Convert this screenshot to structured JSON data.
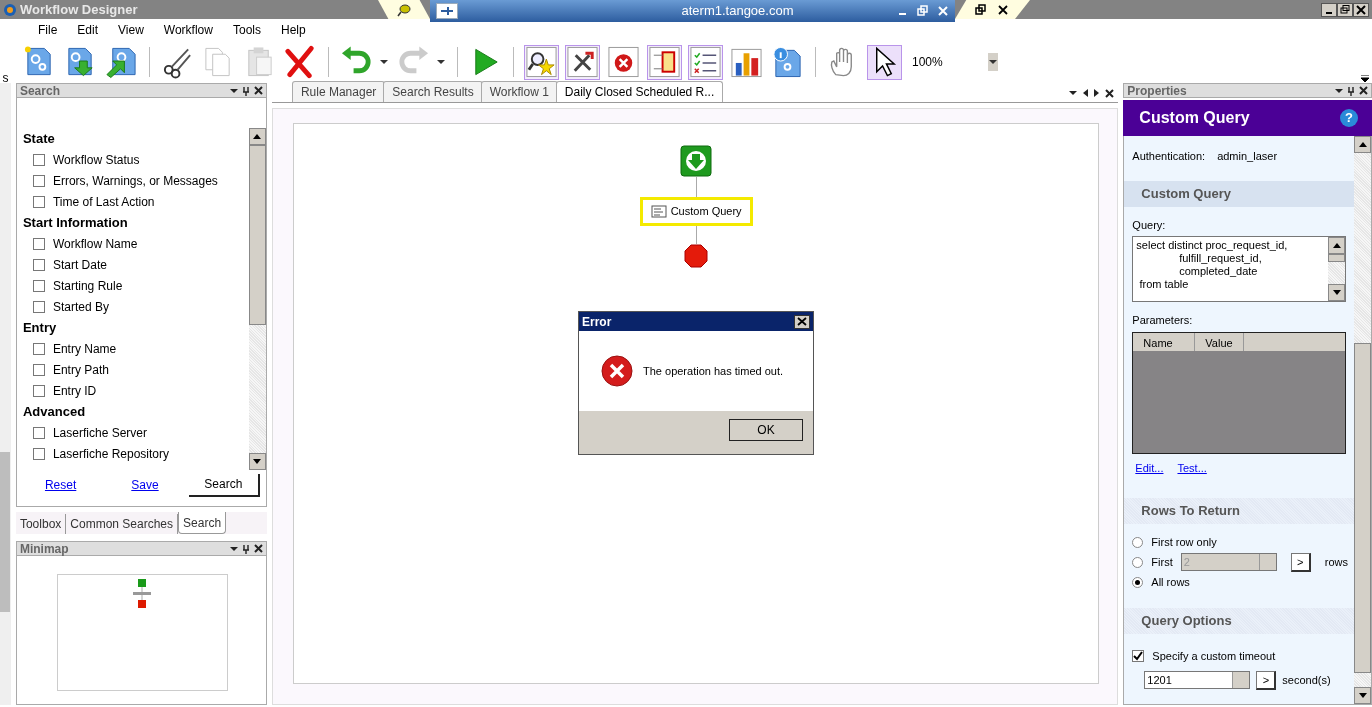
{
  "title_bar": {
    "title": "Workflow Designer"
  },
  "remote_bar": {
    "host": "aterm1.tangoe.com"
  },
  "menu": [
    "File",
    "Edit",
    "View",
    "Workflow",
    "Tools",
    "Help"
  ],
  "left_strip": {
    "label": "s"
  },
  "toolbar": {
    "buttons": [
      {
        "pressed": false,
        "disabled": false
      },
      {
        "pressed": false,
        "disabled": false
      },
      {
        "pressed": false,
        "disabled": false
      },
      {
        "pressed": false,
        "disabled": false
      },
      {
        "pressed": false,
        "disabled": true
      },
      {
        "pressed": false,
        "disabled": true
      },
      {
        "pressed": false,
        "disabled": false
      },
      {
        "pressed": false,
        "disabled": false
      },
      {
        "pressed": false,
        "disabled": true
      },
      {
        "pressed": false,
        "disabled": false
      },
      {
        "pressed": true,
        "disabled": false
      },
      {
        "pressed": true,
        "disabled": false
      },
      {
        "pressed": false,
        "disabled": false
      },
      {
        "pressed": true,
        "disabled": false
      },
      {
        "pressed": true,
        "disabled": false
      },
      {
        "pressed": false,
        "disabled": false
      },
      {
        "pressed": false,
        "disabled": false
      },
      {
        "pressed": false,
        "disabled": false
      },
      {
        "pressed": true,
        "disabled": false
      }
    ],
    "zoom": "100%"
  },
  "search_panel": {
    "title": "Search",
    "sections": [
      {
        "heading": "State",
        "items": [
          {
            "label": "Workflow Status",
            "checked": false
          },
          {
            "label": "Errors, Warnings, or Messages",
            "checked": false
          },
          {
            "label": "Time of Last Action",
            "checked": false
          }
        ]
      },
      {
        "heading": "Start Information",
        "items": [
          {
            "label": "Workflow Name",
            "checked": false
          },
          {
            "label": "Start Date",
            "checked": false
          },
          {
            "label": "Starting Rule",
            "checked": false
          },
          {
            "label": "Started By",
            "checked": false
          }
        ]
      },
      {
        "heading": "Entry",
        "items": [
          {
            "label": "Entry Name",
            "checked": false
          },
          {
            "label": "Entry Path",
            "checked": false
          },
          {
            "label": "Entry ID",
            "checked": false
          }
        ]
      },
      {
        "heading": "Advanced",
        "items": [
          {
            "label": "Laserfiche Server",
            "checked": false
          },
          {
            "label": "Laserfiche Repository",
            "checked": false
          }
        ]
      }
    ],
    "links": [
      "Reset",
      "Save"
    ],
    "button": "Search"
  },
  "left_tabs": [
    {
      "label": "Toolbox",
      "selected": false
    },
    {
      "label": "Common Searches",
      "selected": false
    },
    {
      "label": "Search",
      "selected": true
    }
  ],
  "minimap": {
    "title": "Minimap"
  },
  "doc_tabs": [
    {
      "label": "Rule Manager",
      "selected": false
    },
    {
      "label": "Search Results",
      "selected": false
    },
    {
      "label": "Workflow 1",
      "selected": false
    },
    {
      "label": "Daily Closed Scheduled R...",
      "selected": true
    }
  ],
  "canvas": {
    "activity": {
      "label": "Custom Query",
      "selected": true
    }
  },
  "dialog": {
    "title": "Error",
    "message": "The operation has timed out.",
    "button": "OK"
  },
  "properties": {
    "title": "Properties",
    "header": "Custom Query",
    "help": "?",
    "fields": [
      {
        "label": "Authentication:",
        "value": "admin_laser"
      }
    ],
    "query_section": {
      "heading": "Custom Query",
      "query_label": "Query:",
      "query": "select distinct proc_request_id,\n              fulfill_request_id,\n              completed_date\n from table",
      "parameters_label": "Parameters:",
      "columns": [
        "Name",
        "Value"
      ],
      "links": [
        "Edit...",
        "Test..."
      ]
    },
    "rows_section": {
      "heading": "Rows To Return",
      "options": [
        {
          "label": "First row only",
          "selected": false
        },
        {
          "label": "First",
          "selected": false,
          "count": "2",
          "count_disabled": true,
          "button": ">",
          "suffix": "rows"
        },
        {
          "label": "All rows",
          "selected": true
        }
      ]
    },
    "options_section": {
      "heading": "Query Options",
      "timeout": {
        "label": "Specify a custom timeout",
        "checked": true,
        "value": "1201",
        "button": ">",
        "unit": "second(s)"
      }
    }
  }
}
